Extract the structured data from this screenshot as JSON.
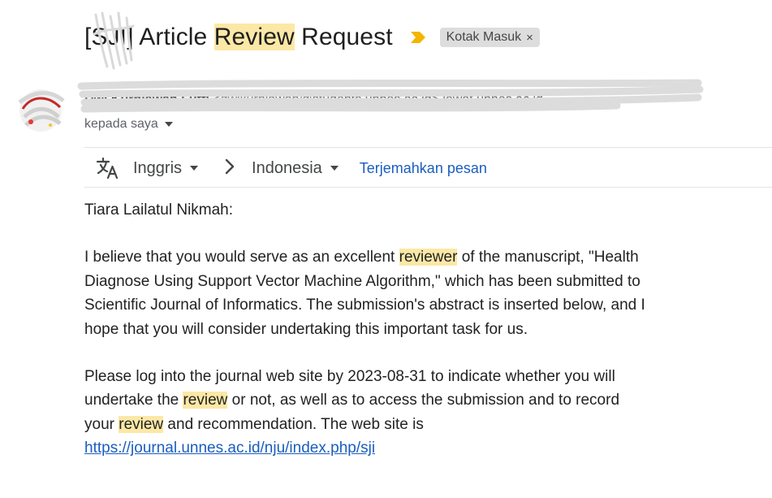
{
  "subject": {
    "before": "[SJI] Article ",
    "highlight": "Review",
    "after": " Request",
    "label": "Kotak Masuk",
    "label_close": "×",
    "importance_color": "#f4b400"
  },
  "sender": {
    "name": "Dwi Kurniawan Lutfi",
    "email": "dwikurniawan@students.unnes.ac.id",
    "unsubscribe": "lewat unnes.ac.id",
    "to_label": "kepada saya"
  },
  "translate": {
    "icon": "translate-icon",
    "from_lang": "Inggris",
    "to_lang": "Indonesia",
    "action": "Terjemahkan pesan"
  },
  "message": {
    "greeting": "Tiara Lailatul Nikmah:",
    "p1": {
      "a": "I believe that you would serve as an excellent ",
      "b": "reviewer",
      "c": " of the manuscript, \"Health Diagnose Using Support Vector Machine Algorithm,\" which has been submitted to Scientific Journal of Informatics. The submission's abstract is inserted below, and I hope that you will consider undertaking this important task for us."
    },
    "p2": {
      "a": "Please log into the journal web site by 2023-08-31 to indicate whether you will undertake the ",
      "b": "review",
      "c": " or not, as well as to access the submission and to record your ",
      "d": "review",
      "e": " and recommendation. The web site is"
    },
    "link": "https://journal.unnes.ac.id/nju/index.php/sji"
  },
  "colors": {
    "highlight": "#fce8a6",
    "link": "#1a5ebf",
    "chip_bg": "#dddddd"
  }
}
